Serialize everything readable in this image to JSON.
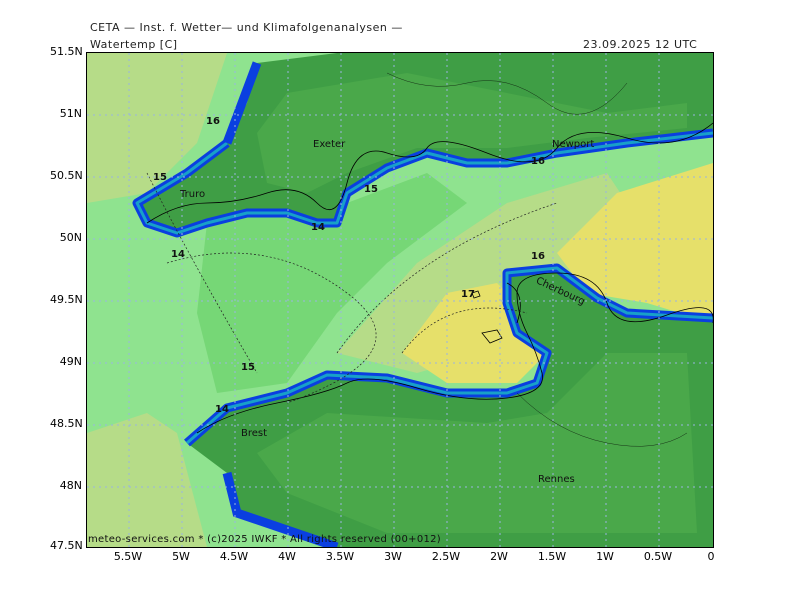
{
  "header": {
    "title": "CETA — Inst. f. Wetter— und Klimafolgenanalysen —",
    "variable": "Watertemp [C]",
    "datetime": "23.09.2025 12 UTC"
  },
  "axes": {
    "lat_labels": [
      "51.5N",
      "51N",
      "50.5N",
      "50N",
      "49.5N",
      "49N",
      "48.5N",
      "48N",
      "47.5N"
    ],
    "lon_labels": [
      "5.5W",
      "5W",
      "4.5W",
      "4W",
      "3.5W",
      "3W",
      "2.5W",
      "2W",
      "1.5W",
      "1W",
      "0.5W",
      "0"
    ]
  },
  "places": [
    {
      "name": "Exeter"
    },
    {
      "name": "Truro"
    },
    {
      "name": "Newport"
    },
    {
      "name": "Cherbourg"
    },
    {
      "name": "Brest"
    },
    {
      "name": "Rennes"
    }
  ],
  "isolines": [
    "16",
    "15",
    "15",
    "14",
    "14",
    "16",
    "16",
    "17",
    "15",
    "14"
  ],
  "footer": "meteo-services.com * (c)2025 IWKF * All rights reserved (00+012)",
  "colors": {
    "land_dark": "#3f9e45",
    "land_mid": "#4aa84a",
    "sea_14": "#66cf66",
    "sea_15": "#8fe38f",
    "sea_16": "#b6dc88",
    "sea_17": "#e6e06a",
    "coast_blue": "#0a3fe0",
    "coast_cyan": "#18a0c8"
  }
}
